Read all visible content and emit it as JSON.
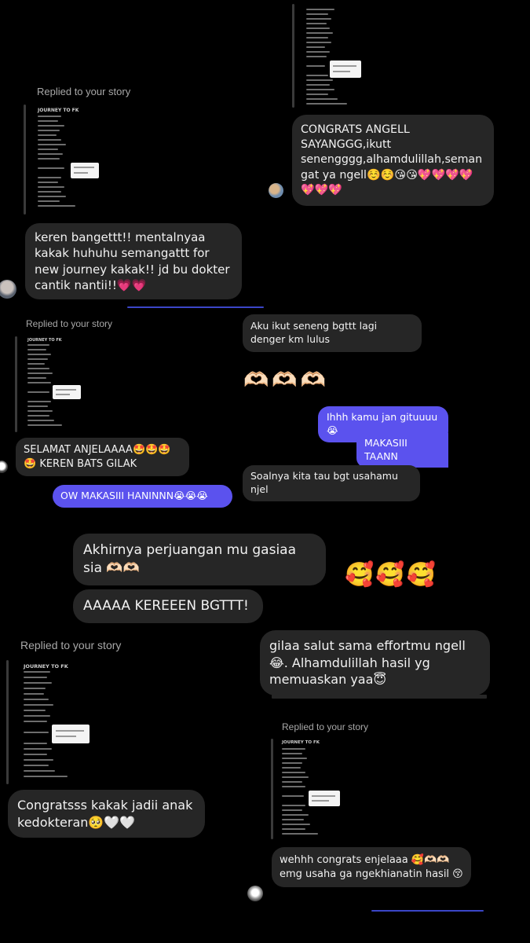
{
  "section1": {
    "reply_label": "Replied to your story",
    "story_title": "JOURNEY TO FK",
    "incoming": "keren bangettt!! mentalnyaa kakak huhuhu semangattt for new journey kakak!! jd bu dokter cantik nantii!!💗💗",
    "right_message": "CONGRATS ANGELL SAYANGGG,ikutt senengggg,alhamdulillah,semangat ya ngell☺️☺️😘😘💖💖💖💖💖💖💖"
  },
  "section2": {
    "reply_label": "Replied to your story",
    "story_title": "JOURNEY TO FK",
    "incoming": "SELAMAT ANJELAAAA🤩🤩🤩\n🤩 KEREN BATS GILAK",
    "reply_out": "OW MAKASIII HANINNN😭😭😭",
    "right_in_1": "Aku ikut seneng bgttt lagi denger km lulus",
    "hearts": "🫶🏻🫶🏻🫶🏻",
    "out_1": "Ihhh kamu jan gituuuu😭",
    "out_2": "MAKASIII TAANN",
    "right_in_2": "Soalnya kita tau bgt usahamu njel"
  },
  "section3": {
    "msg_1": "Akhirnya perjuangan mu gasiaa sia 🫶🏻🫶🏻",
    "msg_2": "AAAAA KEREEEN BGTTT!",
    "reaction": "🥰🥰🥰"
  },
  "section4": {
    "reply_label": "Replied to your story",
    "story_title": "JOURNEY TO FK",
    "incoming": "Congratsss kakak jadii anak kedokteran🥺🤍🤍",
    "right_message": "gilaa salut sama effortmu ngell😂. Alhamdulillah hasil yg memuaskan yaa😇"
  },
  "section5": {
    "reply_label": "Replied to your story",
    "story_title": "JOURNEY TO FK",
    "incoming": "wehhh congrats enjelaaa 🥰🫶🏻🫶🏻 emg usaha ga ngekhianatin hasil 😚"
  },
  "colors": {
    "background": "#000000",
    "bubble": "#262626",
    "outgoing": "#5b52ee",
    "label": "#a8a8a8"
  }
}
